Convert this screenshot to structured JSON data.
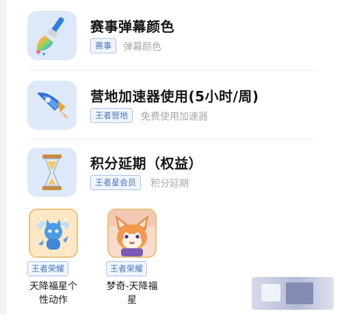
{
  "benefits": [
    {
      "title": "赛事弹幕颜色",
      "tag": "赛事",
      "subtitle": "弹幕颜色",
      "icon": "paintbrush-icon"
    },
    {
      "title": "营地加速器使用(5小时/周)",
      "tag": "王者营地",
      "subtitle": "免费使用加速器",
      "icon": "rocket-icon"
    },
    {
      "title": "积分延期（权益）",
      "tag": "王者星会员",
      "subtitle": "积分延期",
      "icon": "hourglass-icon"
    }
  ],
  "rewards": [
    {
      "tag": "王者荣耀",
      "name": "天降福星个性动作",
      "icon": "blue-cat-icon"
    },
    {
      "tag": "王者荣耀",
      "name": "梦奇-天降福星",
      "icon": "fox-avatar-icon"
    }
  ],
  "colors": {
    "tag_text": "#4a73b8",
    "tag_border": "#a9c1e6",
    "icon_tile_bg": "#dde9f8",
    "reward_border": "#e8c17f"
  }
}
